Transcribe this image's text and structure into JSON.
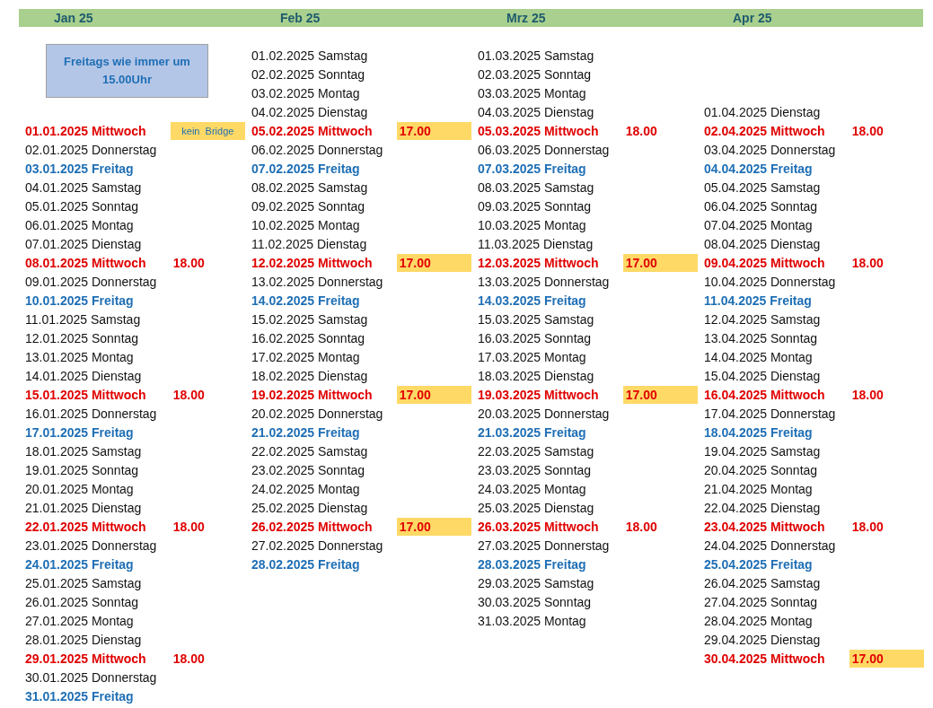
{
  "months": [
    {
      "label": "Jan 25",
      "note": "Freitags wie immer um 15.00Uhr",
      "days": [
        {
          "text": "01.01.2025 Mittwoch",
          "kind": "wed",
          "time": {
            "text": "kein  Bridge",
            "kind": "note",
            "highlighted": true
          }
        },
        {
          "text": "02.01.2025 Donnerstag",
          "kind": "thu"
        },
        {
          "text": "03.01.2025 Freitag",
          "kind": "fri"
        },
        {
          "text": "04.01.2025 Samstag",
          "kind": "sat"
        },
        {
          "text": "05.01.2025 Sonntag",
          "kind": "sun"
        },
        {
          "text": "06.01.2025 Montag",
          "kind": "mon"
        },
        {
          "text": "07.01.2025 Dienstag",
          "kind": "tue"
        },
        {
          "text": "08.01.2025 Mittwoch",
          "kind": "wed",
          "time": {
            "text": "18.00",
            "kind": "time",
            "highlighted": false
          }
        },
        {
          "text": "09.01.2025 Donnerstag",
          "kind": "thu"
        },
        {
          "text": "10.01.2025 Freitag",
          "kind": "fri"
        },
        {
          "text": "11.01.2025 Samstag",
          "kind": "sat"
        },
        {
          "text": "12.01.2025 Sonntag",
          "kind": "sun"
        },
        {
          "text": "13.01.2025 Montag",
          "kind": "mon"
        },
        {
          "text": "14.01.2025 Dienstag",
          "kind": "tue"
        },
        {
          "text": "15.01.2025 Mittwoch",
          "kind": "wed",
          "time": {
            "text": "18.00",
            "kind": "time",
            "highlighted": false
          }
        },
        {
          "text": "16.01.2025 Donnerstag",
          "kind": "thu"
        },
        {
          "text": "17.01.2025 Freitag",
          "kind": "fri"
        },
        {
          "text": "18.01.2025 Samstag",
          "kind": "sat"
        },
        {
          "text": "19.01.2025 Sonntag",
          "kind": "sun"
        },
        {
          "text": "20.01.2025 Montag",
          "kind": "mon"
        },
        {
          "text": "21.01.2025 Dienstag",
          "kind": "tue"
        },
        {
          "text": "22.01.2025 Mittwoch",
          "kind": "wed",
          "time": {
            "text": "18.00",
            "kind": "time",
            "highlighted": false
          }
        },
        {
          "text": "23.01.2025 Donnerstag",
          "kind": "thu"
        },
        {
          "text": "24.01.2025 Freitag",
          "kind": "fri"
        },
        {
          "text": "25.01.2025 Samstag",
          "kind": "sat"
        },
        {
          "text": "26.01.2025 Sonntag",
          "kind": "sun"
        },
        {
          "text": "27.01.2025 Montag",
          "kind": "mon"
        },
        {
          "text": "28.01.2025 Dienstag",
          "kind": "tue"
        },
        {
          "text": "29.01.2025 Mittwoch",
          "kind": "wed",
          "time": {
            "text": "18.00",
            "kind": "time",
            "highlighted": false
          }
        },
        {
          "text": "30.01.2025 Donnerstag",
          "kind": "thu"
        },
        {
          "text": "31.01.2025 Freitag",
          "kind": "fri"
        }
      ]
    },
    {
      "label": "Feb 25",
      "days": [
        {
          "text": "01.02.2025 Samstag",
          "kind": "sat"
        },
        {
          "text": "02.02.2025 Sonntag",
          "kind": "sun"
        },
        {
          "text": "03.02.2025 Montag",
          "kind": "mon"
        },
        {
          "text": "04.02.2025 Dienstag",
          "kind": "tue"
        },
        {
          "text": "05.02.2025 Mittwoch",
          "kind": "wed",
          "time": {
            "text": "17.00",
            "kind": "time",
            "highlighted": true
          }
        },
        {
          "text": "06.02.2025 Donnerstag",
          "kind": "thu"
        },
        {
          "text": "07.02.2025 Freitag",
          "kind": "fri"
        },
        {
          "text": "08.02.2025 Samstag",
          "kind": "sat"
        },
        {
          "text": "09.02.2025 Sonntag",
          "kind": "sun"
        },
        {
          "text": "10.02.2025 Montag",
          "kind": "mon"
        },
        {
          "text": "11.02.2025 Dienstag",
          "kind": "tue"
        },
        {
          "text": "12.02.2025 Mittwoch",
          "kind": "wed",
          "time": {
            "text": "17.00",
            "kind": "time",
            "highlighted": true
          }
        },
        {
          "text": "13.02.2025 Donnerstag",
          "kind": "thu"
        },
        {
          "text": "14.02.2025 Freitag",
          "kind": "fri"
        },
        {
          "text": "15.02.2025 Samstag",
          "kind": "sat"
        },
        {
          "text": "16.02.2025 Sonntag",
          "kind": "sun"
        },
        {
          "text": "17.02.2025 Montag",
          "kind": "mon"
        },
        {
          "text": "18.02.2025 Dienstag",
          "kind": "tue"
        },
        {
          "text": "19.02.2025 Mittwoch",
          "kind": "wed",
          "time": {
            "text": "17.00",
            "kind": "time",
            "highlighted": true
          }
        },
        {
          "text": "20.02.2025 Donnerstag",
          "kind": "thu"
        },
        {
          "text": "21.02.2025 Freitag",
          "kind": "fri"
        },
        {
          "text": "22.02.2025 Samstag",
          "kind": "sat"
        },
        {
          "text": "23.02.2025 Sonntag",
          "kind": "sun"
        },
        {
          "text": "24.02.2025 Montag",
          "kind": "mon"
        },
        {
          "text": "25.02.2025 Dienstag",
          "kind": "tue"
        },
        {
          "text": "26.02.2025 Mittwoch",
          "kind": "wed",
          "time": {
            "text": "17.00",
            "kind": "time",
            "highlighted": true
          }
        },
        {
          "text": "27.02.2025 Donnerstag",
          "kind": "thu"
        },
        {
          "text": "28.02.2025 Freitag",
          "kind": "fri"
        }
      ]
    },
    {
      "label": "Mrz 25",
      "days": [
        {
          "text": "01.03.2025 Samstag",
          "kind": "sat"
        },
        {
          "text": "02.03.2025 Sonntag",
          "kind": "sun"
        },
        {
          "text": "03.03.2025 Montag",
          "kind": "mon"
        },
        {
          "text": "04.03.2025 Dienstag",
          "kind": "tue"
        },
        {
          "text": "05.03.2025 Mittwoch",
          "kind": "wed",
          "time": {
            "text": "18.00",
            "kind": "time",
            "highlighted": false
          }
        },
        {
          "text": "06.03.2025 Donnerstag",
          "kind": "thu"
        },
        {
          "text": "07.03.2025 Freitag",
          "kind": "fri"
        },
        {
          "text": "08.03.2025 Samstag",
          "kind": "sat"
        },
        {
          "text": "09.03.2025 Sonntag",
          "kind": "sun"
        },
        {
          "text": "10.03.2025 Montag",
          "kind": "mon"
        },
        {
          "text": "11.03.2025 Dienstag",
          "kind": "tue"
        },
        {
          "text": "12.03.2025 Mittwoch",
          "kind": "wed",
          "time": {
            "text": "17.00",
            "kind": "time",
            "highlighted": true
          }
        },
        {
          "text": "13.03.2025 Donnerstag",
          "kind": "thu"
        },
        {
          "text": "14.03.2025 Freitag",
          "kind": "fri"
        },
        {
          "text": "15.03.2025 Samstag",
          "kind": "sat"
        },
        {
          "text": "16.03.2025 Sonntag",
          "kind": "sun"
        },
        {
          "text": "17.03.2025 Montag",
          "kind": "mon"
        },
        {
          "text": "18.03.2025 Dienstag",
          "kind": "tue"
        },
        {
          "text": "19.03.2025 Mittwoch",
          "kind": "wed",
          "time": {
            "text": "17.00",
            "kind": "time",
            "highlighted": true
          }
        },
        {
          "text": "20.03.2025 Donnerstag",
          "kind": "thu"
        },
        {
          "text": "21.03.2025 Freitag",
          "kind": "fri"
        },
        {
          "text": "22.03.2025 Samstag",
          "kind": "sat"
        },
        {
          "text": "23.03.2025 Sonntag",
          "kind": "sun"
        },
        {
          "text": "24.03.2025 Montag",
          "kind": "mon"
        },
        {
          "text": "25.03.2025 Dienstag",
          "kind": "tue"
        },
        {
          "text": "26.03.2025 Mittwoch",
          "kind": "wed",
          "time": {
            "text": "18.00",
            "kind": "time",
            "highlighted": false
          }
        },
        {
          "text": "27.03.2025 Donnerstag",
          "kind": "thu"
        },
        {
          "text": "28.03.2025 Freitag",
          "kind": "fri"
        },
        {
          "text": "29.03.2025 Samstag",
          "kind": "sat"
        },
        {
          "text": "30.03.2025 Sonntag",
          "kind": "sun"
        },
        {
          "text": "31.03.2025 Montag",
          "kind": "mon"
        }
      ]
    },
    {
      "label": "Apr 25",
      "days": [
        {
          "text": "01.04.2025 Dienstag",
          "kind": "tue"
        },
        {
          "text": "02.04.2025 Mittwoch",
          "kind": "wed",
          "time": {
            "text": "18.00",
            "kind": "time",
            "highlighted": false
          }
        },
        {
          "text": "03.04.2025 Donnerstag",
          "kind": "thu"
        },
        {
          "text": "04.04.2025 Freitag",
          "kind": "fri"
        },
        {
          "text": "05.04.2025 Samstag",
          "kind": "sat"
        },
        {
          "text": "06.04.2025 Sonntag",
          "kind": "sun"
        },
        {
          "text": "07.04.2025 Montag",
          "kind": "mon"
        },
        {
          "text": "08.04.2025 Dienstag",
          "kind": "tue"
        },
        {
          "text": "09.04.2025 Mittwoch",
          "kind": "wed",
          "time": {
            "text": "18.00",
            "kind": "time",
            "highlighted": false
          }
        },
        {
          "text": "10.04.2025 Donnerstag",
          "kind": "thu"
        },
        {
          "text": "11.04.2025 Freitag",
          "kind": "fri"
        },
        {
          "text": "12.04.2025 Samstag",
          "kind": "sat"
        },
        {
          "text": "13.04.2025 Sonntag",
          "kind": "sun"
        },
        {
          "text": "14.04.2025 Montag",
          "kind": "mon"
        },
        {
          "text": "15.04.2025 Dienstag",
          "kind": "tue"
        },
        {
          "text": "16.04.2025 Mittwoch",
          "kind": "wed",
          "time": {
            "text": "18.00",
            "kind": "time",
            "highlighted": false
          }
        },
        {
          "text": "17.04.2025 Donnerstag",
          "kind": "thu"
        },
        {
          "text": "18.04.2025 Freitag",
          "kind": "fri"
        },
        {
          "text": "19.04.2025 Samstag",
          "kind": "sat"
        },
        {
          "text": "20.04.2025 Sonntag",
          "kind": "sun"
        },
        {
          "text": "21.04.2025 Montag",
          "kind": "mon"
        },
        {
          "text": "22.04.2025 Dienstag",
          "kind": "tue"
        },
        {
          "text": "23.04.2025 Mittwoch",
          "kind": "wed",
          "time": {
            "text": "18.00",
            "kind": "time",
            "highlighted": false
          }
        },
        {
          "text": "24.04.2025 Donnerstag",
          "kind": "thu"
        },
        {
          "text": "25.04.2025 Freitag",
          "kind": "fri"
        },
        {
          "text": "26.04.2025 Samstag",
          "kind": "sat"
        },
        {
          "text": "27.04.2025 Sonntag",
          "kind": "sun"
        },
        {
          "text": "28.04.2025 Montag",
          "kind": "mon"
        },
        {
          "text": "29.04.2025 Dienstag",
          "kind": "tue"
        },
        {
          "text": "30.04.2025 Mittwoch",
          "kind": "wed",
          "time": {
            "text": "17.00",
            "kind": "time",
            "highlighted": true
          }
        }
      ]
    }
  ]
}
